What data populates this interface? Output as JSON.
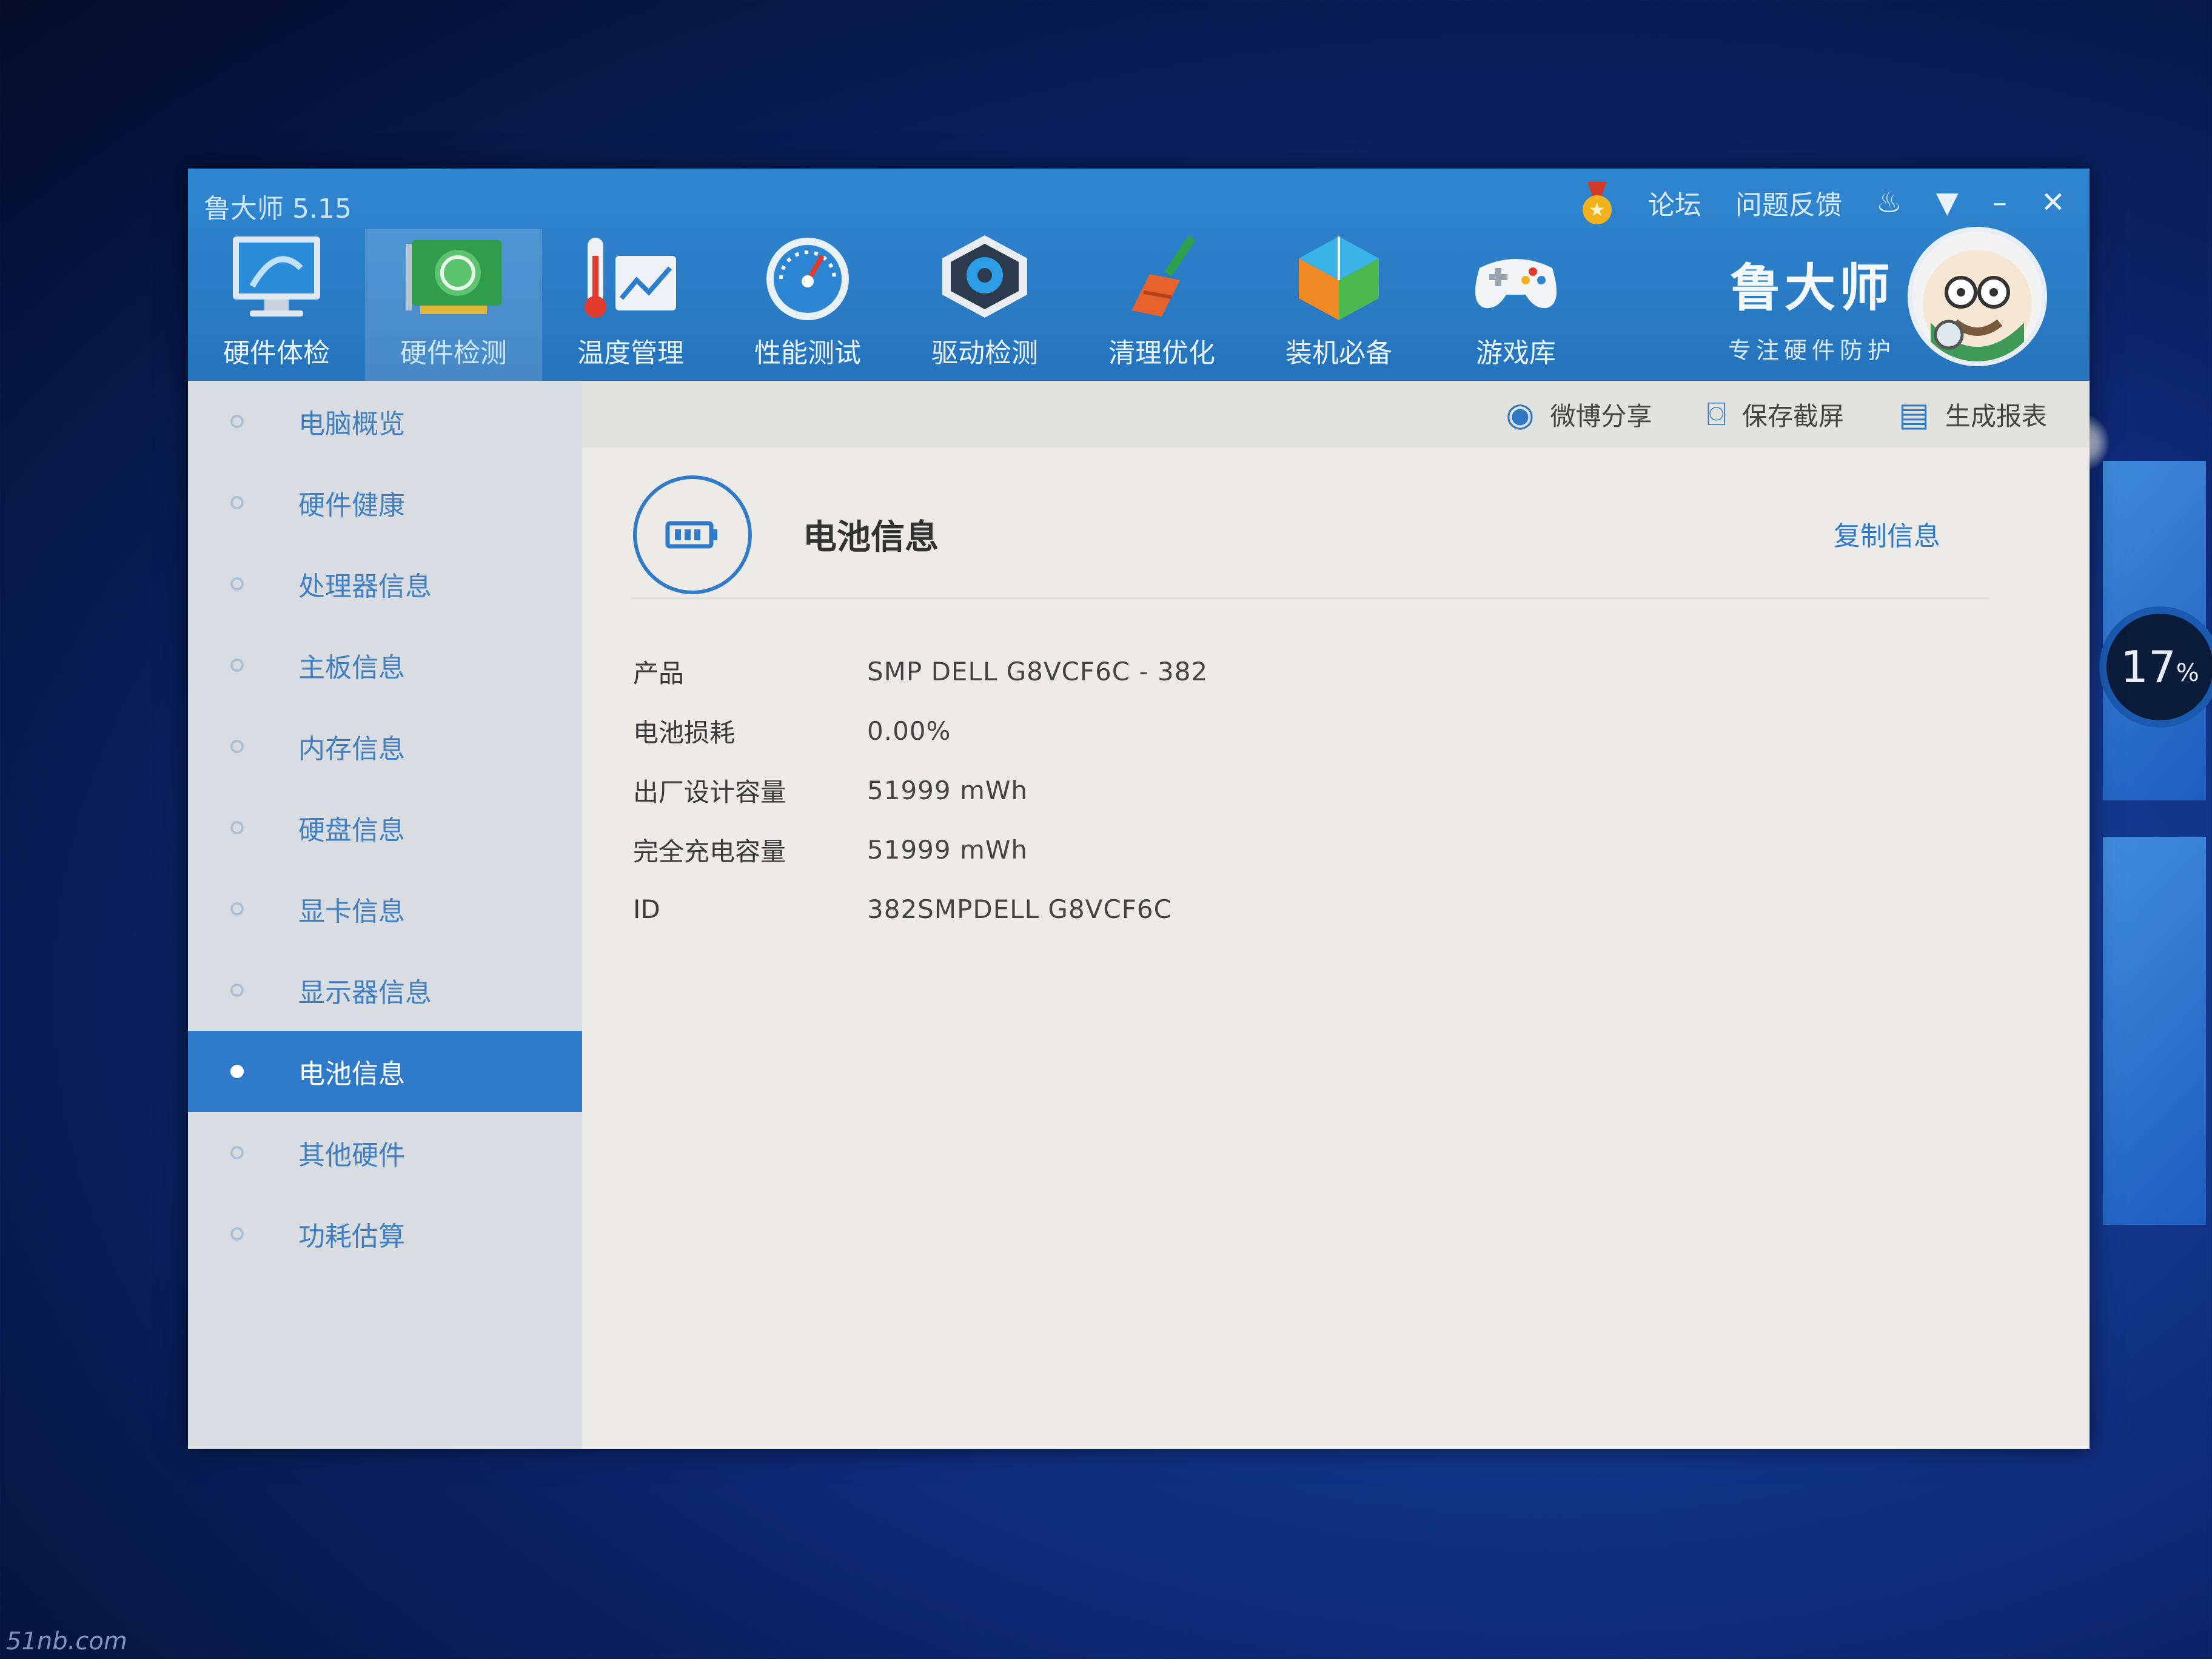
{
  "window": {
    "title": "鲁大师 5.15"
  },
  "title_bar": {
    "forum": "论坛",
    "feedback": "问题反馈",
    "minimize": "–",
    "close": "✕"
  },
  "toolbar": [
    {
      "label": "硬件体检",
      "icon": "monitor-icon"
    },
    {
      "label": "硬件检测",
      "icon": "graphics-card-icon"
    },
    {
      "label": "温度管理",
      "icon": "thermometer-icon"
    },
    {
      "label": "性能测试",
      "icon": "speedometer-icon"
    },
    {
      "label": "驱动检测",
      "icon": "gear-chip-icon"
    },
    {
      "label": "清理优化",
      "icon": "broom-icon"
    },
    {
      "label": "装机必备",
      "icon": "cube-icon"
    },
    {
      "label": "游戏库",
      "icon": "gamepad-icon"
    }
  ],
  "brand": {
    "name": "鲁大师",
    "slogan": "专注硬件防护"
  },
  "sidebar": {
    "items": [
      {
        "label": "电脑概览"
      },
      {
        "label": "硬件健康"
      },
      {
        "label": "处理器信息"
      },
      {
        "label": "主板信息"
      },
      {
        "label": "内存信息"
      },
      {
        "label": "硬盘信息"
      },
      {
        "label": "显卡信息"
      },
      {
        "label": "显示器信息"
      },
      {
        "label": "电池信息"
      },
      {
        "label": "其他硬件"
      },
      {
        "label": "功耗估算"
      }
    ],
    "active_index": 8
  },
  "actions": {
    "weibo": "微博分享",
    "screenshot": "保存截屏",
    "report": "生成报表"
  },
  "panel": {
    "title": "电池信息",
    "copy": "复制信息",
    "rows": [
      {
        "key": "产品",
        "value": "SMP DELL G8VCF6C - 382"
      },
      {
        "key": "电池损耗",
        "value": "0.00%"
      },
      {
        "key": "出厂设计容量",
        "value": "51999 mWh"
      },
      {
        "key": "完全充电容量",
        "value": "51999 mWh"
      },
      {
        "key": "ID",
        "value": "382SMPDELL G8VCF6C"
      }
    ]
  },
  "desktop": {
    "gauge_value": "17",
    "gauge_unit": "%",
    "watermark": "51nb.com"
  },
  "colors": {
    "header": "#2a7dc6",
    "accent": "#2f7ac9",
    "sidebar": "#d9dde1",
    "content": "#ecebe8"
  }
}
